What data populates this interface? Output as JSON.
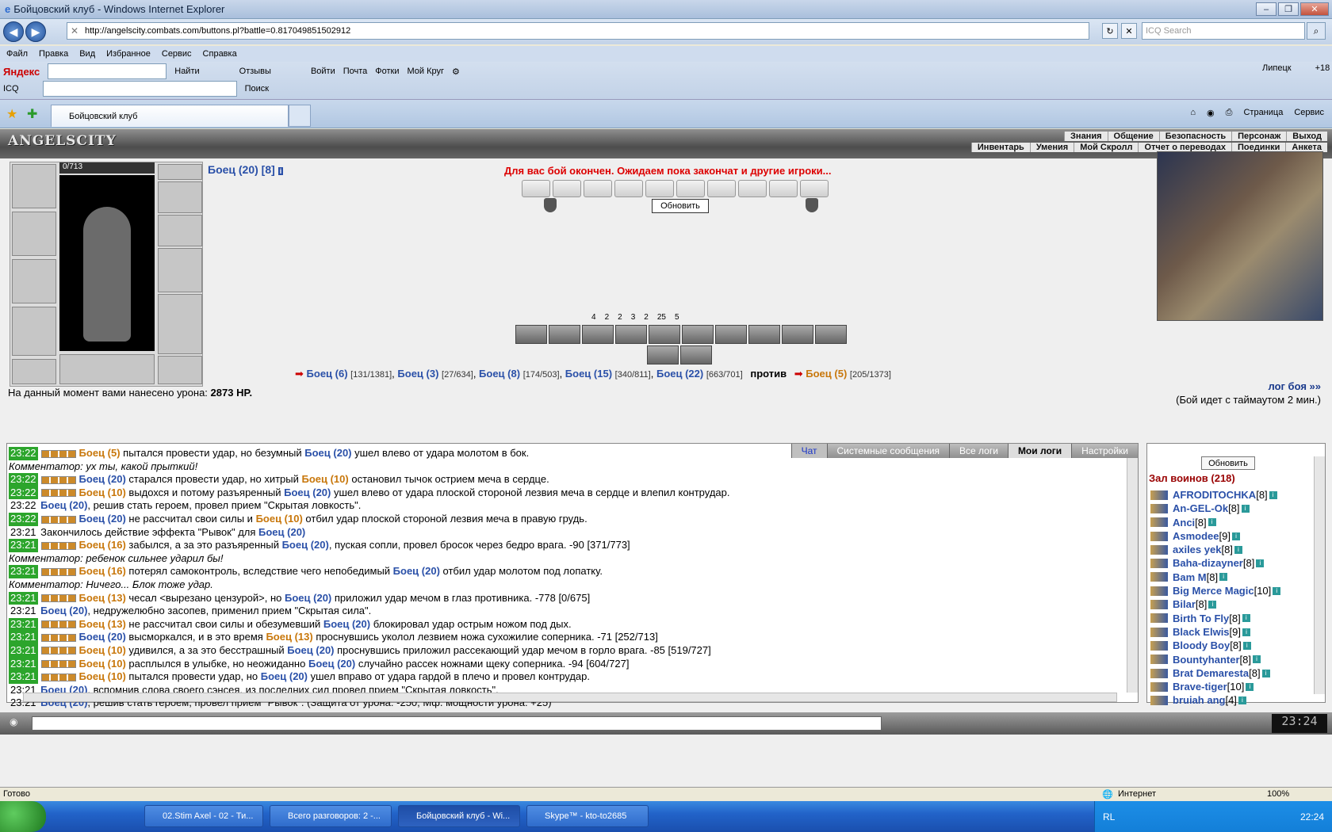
{
  "window": {
    "title": "Бойцовский клуб - Windows Internet Explorer"
  },
  "address": {
    "url": "http://angelscity.combats.com/buttons.pl?battle=0.817049851502912",
    "search_placeholder": "ICQ Search"
  },
  "menu": [
    "Файл",
    "Правка",
    "Вид",
    "Избранное",
    "Сервис",
    "Справка"
  ],
  "yandex": {
    "brand": "Яндекс",
    "find": "Найти",
    "reviews": "Отзывы",
    "login": "Войти",
    "mail": "Почта",
    "photos": "Фотки",
    "circle": "Мой Круг",
    "icq": "ICQ",
    "search": "Поиск",
    "city": "Липецк",
    "temp": "+18"
  },
  "tab": {
    "label": "Бойцовский клуб"
  },
  "commands": {
    "page": "Страница",
    "service": "Сервис"
  },
  "game": {
    "logo": "ANGELSCITY",
    "menu_top": [
      "Знания",
      "Общение",
      "Безопасность",
      "Персонаж",
      "Выход"
    ],
    "menu_bottom": [
      "Инвентарь",
      "Умения",
      "Мой Скролл",
      "Отчет о переводах",
      "Поединки",
      "Анкета"
    ],
    "hp": "0/713",
    "fighter": "Боец (20) [8]",
    "banner": "Для вас бой окончен. Ожидаем пока закончат и другие игроки...",
    "refresh": "Обновить",
    "stats": [
      "4",
      "2",
      "2",
      "3",
      "2",
      "25",
      "5"
    ],
    "teams": [
      {
        "name": "Боец (6)",
        "hp": "[131/1381]"
      },
      {
        "name": "Боец (3)",
        "hp": "[27/634]"
      },
      {
        "name": "Боец (8)",
        "hp": "[174/503]"
      },
      {
        "name": "Боец (15)",
        "hp": "[340/811]"
      },
      {
        "name": "Боец (22)",
        "hp": "[663/701]"
      }
    ],
    "vs": "против",
    "enemy": {
      "name": "Боец (5)",
      "hp": "[205/1373]"
    },
    "damage_label": "На данный момент вами нанесено урона:",
    "damage_value": "2873 HP.",
    "log_link": "лог боя »»",
    "timeout": "(Бой идет с таймаутом 2 мин.)"
  },
  "chat": {
    "tabs": [
      "Чат",
      "Системные сообщения",
      "Все логи",
      "Мои логи",
      "Настройки"
    ],
    "lines": [
      {
        "t": "23:22",
        "g": true,
        "a": "Боец (5)",
        "ac": "f1",
        "txt": " пытался провести удар, но безумный ",
        "b": "Боец (20)",
        "bc": "f2",
        "rest": " ушел влево от удара молотом в бок."
      },
      {
        "com": "Комментатор: ух ты, какой прыткий!"
      },
      {
        "t": "23:22",
        "g": true,
        "a": "Боец (20)",
        "ac": "f2",
        "txt": " старался провести удар, но хитрый ",
        "b": "Боец (10)",
        "bc": "f1",
        "rest": " остановил тычок острием меча в сердце."
      },
      {
        "t": "23:22",
        "g": true,
        "a": "Боец (10)",
        "ac": "f1",
        "txt": " выдохся и потому разъяренный ",
        "b": "Боец (20)",
        "bc": "f2",
        "rest": " ушел влево от удара плоской стороной лезвия меча в сердце и влепил контрудар."
      },
      {
        "t": "23:22",
        "g": false,
        "a": "Боец (20)",
        "ac": "f2",
        "txt": ", решив стать героем, провел прием \"Скрытая ловкость\".",
        "b": "",
        "bc": "",
        "rest": ""
      },
      {
        "t": "23:22",
        "g": true,
        "a": "Боец (20)",
        "ac": "f2",
        "txt": " не рассчитал свои силы и ",
        "b": "Боец (10)",
        "bc": "f1",
        "rest": " отбил удар плоской стороной лезвия меча в правую грудь."
      },
      {
        "t": "23:21",
        "g": false,
        "a": "",
        "ac": "",
        "txt": "Закончилось действие эффекта \"Рывок\" для ",
        "b": "Боец (20)",
        "bc": "f2",
        "rest": ""
      },
      {
        "t": "23:21",
        "g": true,
        "a": "Боец (16)",
        "ac": "f1",
        "txt": " забылся, а за это разъяренный ",
        "b": "Боец (20)",
        "bc": "f2",
        "rest": ", пуская сопли, провел бросок через бедро врага. -90 [371/773]"
      },
      {
        "com": "Комментатор: ребенок сильнее ударил бы!"
      },
      {
        "t": "23:21",
        "g": true,
        "a": "Боец (16)",
        "ac": "f1",
        "txt": " потерял самоконтроль, вследствие чего непобедимый ",
        "b": "Боец (20)",
        "bc": "f2",
        "rest": " отбил удар молотом под лопатку."
      },
      {
        "com": "Комментатор: Ничего... Блок тоже удар."
      },
      {
        "t": "23:21",
        "g": true,
        "a": "Боец (13)",
        "ac": "f1",
        "txt": " чесал <вырезано цензурой>, но ",
        "b": "Боец (20)",
        "bc": "f2",
        "rest": " приложил удар мечом в глаз противника. -778 [0/675]"
      },
      {
        "t": "23:21",
        "g": false,
        "a": "Боец (20)",
        "ac": "f2",
        "txt": ", недружелюбно засопев, применил прием \"Скрытая сила\".",
        "b": "",
        "bc": "",
        "rest": ""
      },
      {
        "t": "23:21",
        "g": true,
        "a": "Боец (13)",
        "ac": "f1",
        "txt": " не рассчитал свои силы и обезумевший ",
        "b": "Боец (20)",
        "bc": "f2",
        "rest": " блокировал удар острым ножом под дых."
      },
      {
        "t": "23:21",
        "g": true,
        "a": "Боец (20)",
        "ac": "f2",
        "txt": " высморкался, и в это время ",
        "b": "Боец (13)",
        "bc": "f1",
        "rest": " проснувшись уколол лезвием ножа сухожилие соперника. -71 [252/713]"
      },
      {
        "t": "23:21",
        "g": true,
        "a": "Боец (10)",
        "ac": "f1",
        "txt": " удивился, а за это бесстрашный ",
        "b": "Боец (20)",
        "bc": "f2",
        "rest": " проснувшись приложил рассекающий удар мечом в горло врага. -85 [519/727]"
      },
      {
        "t": "23:21",
        "g": true,
        "a": "Боец (10)",
        "ac": "f1",
        "txt": " расплылся в улыбке, но неожиданно ",
        "b": "Боец (20)",
        "bc": "f2",
        "rest": " случайно рассек ножнами щеку соперника. -94 [604/727]"
      },
      {
        "t": "23:21",
        "g": true,
        "a": "Боец (10)",
        "ac": "f1",
        "txt": " пытался провести удар, но ",
        "b": "Боец (20)",
        "bc": "f2",
        "rest": " ушел вправо от удара гардой в плечо и провел контрудар."
      },
      {
        "t": "23:21",
        "g": false,
        "a": "Боец (20)",
        "ac": "f2",
        "txt": ", вспомнив слова своего сэнсея, из последних сил провел прием \"Скрытая ловкость\".",
        "b": "",
        "bc": "",
        "rest": ""
      },
      {
        "t": "23:21",
        "g": false,
        "a": "Боец (20)",
        "ac": "f2",
        "txt": ", решив стать героем, провел прием \"Рывок\". (Защита от урона: -250, Мф. мощности урона: +25)",
        "b": "",
        "bc": "",
        "rest": ""
      }
    ]
  },
  "users": {
    "refresh": "Обновить",
    "title": "Зал воинов (218)",
    "list": [
      {
        "n": "AFRODITOCHKA",
        "l": "[8]"
      },
      {
        "n": "An-GEL-Ok",
        "l": "[8]"
      },
      {
        "n": "Anci",
        "l": "[8]"
      },
      {
        "n": "Asmodee",
        "l": "[9]"
      },
      {
        "n": "axiles yek",
        "l": "[8]"
      },
      {
        "n": "Baha-dizayner",
        "l": "[8]"
      },
      {
        "n": "Bam M",
        "l": "[8]"
      },
      {
        "n": "Big Merce Magic",
        "l": "[10]"
      },
      {
        "n": "Bilar",
        "l": "[8]"
      },
      {
        "n": "Birth To Fly",
        "l": "[8]"
      },
      {
        "n": "Black Elwis",
        "l": "[9]"
      },
      {
        "n": "Bloody Boy",
        "l": "[8]"
      },
      {
        "n": "Bountyhanter",
        "l": "[8]"
      },
      {
        "n": "Brat Demaresta",
        "l": "[8]"
      },
      {
        "n": "Brave-tiger",
        "l": "[10]"
      },
      {
        "n": "bruiah ang",
        "l": "[4]"
      }
    ]
  },
  "clock": "23:24",
  "status": {
    "left": "Готово",
    "zone": "Интернет",
    "zoom": "100%"
  },
  "taskbar": {
    "items": [
      "02.Stim Axel - 02 - Ти...",
      "Всего разговоров: 2 -...",
      "Бойцовский клуб - Wi...",
      "Skype™ - kto-to2685"
    ],
    "lang": "RL",
    "time": "22:24"
  }
}
